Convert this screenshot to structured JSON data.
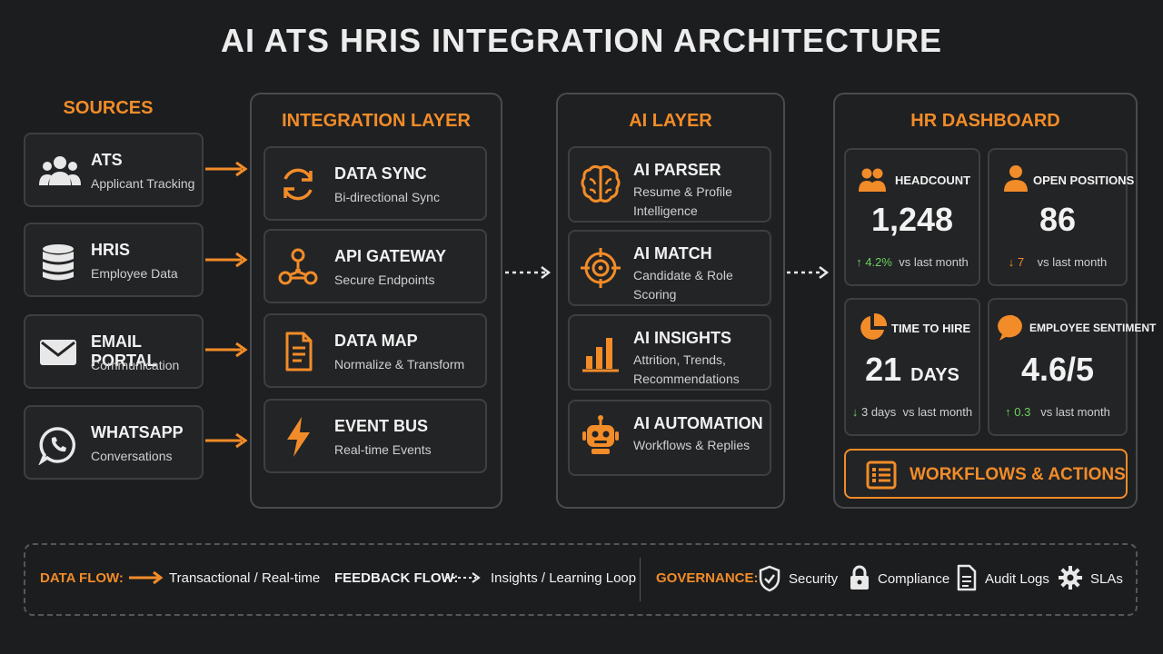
{
  "title": "AI ATS HRIS INTEGRATION ARCHITECTURE",
  "sources": {
    "title": "SOURCES",
    "items": [
      {
        "name": "ATS",
        "desc": "Applicant Tracking",
        "icon": "users-icon"
      },
      {
        "name": "HRIS",
        "desc": "Employee Data",
        "icon": "database-icon"
      },
      {
        "name": "EMAIL PORTAL",
        "desc": "Communication",
        "icon": "mail-icon"
      },
      {
        "name": "WHATSAPP",
        "desc": "Conversations",
        "icon": "whatsapp-icon"
      }
    ]
  },
  "integration": {
    "title": "INTEGRATION LAYER",
    "items": [
      {
        "name": "DATA SYNC",
        "desc": "Bi-directional Sync",
        "icon": "sync-icon"
      },
      {
        "name": "API GATEWAY",
        "desc": "Secure Endpoints",
        "icon": "network-icon"
      },
      {
        "name": "DATA MAP",
        "desc": "Normalize & Transform",
        "icon": "document-icon"
      },
      {
        "name": "EVENT BUS",
        "desc": "Real-time Events",
        "icon": "lightning-icon"
      }
    ]
  },
  "ai": {
    "title": "AI LAYER",
    "items": [
      {
        "name": "AI PARSER",
        "desc": "Resume & Profile Intelligence",
        "icon": "brain-icon"
      },
      {
        "name": "AI MATCH",
        "desc": "Candidate & Role Scoring",
        "icon": "target-icon"
      },
      {
        "name": "AI INSIGHTS",
        "desc": "Attrition, Trends, Recommendations",
        "icon": "bar-chart-icon"
      },
      {
        "name": "AI AUTOMATION",
        "desc": "Workflows & Replies",
        "icon": "robot-icon"
      }
    ]
  },
  "dashboard": {
    "title": "HR DASHBOARD",
    "kpis": [
      {
        "label": "HEADCOUNT",
        "value": "1,248",
        "delta": "4.2%",
        "delta_suffix": "vs last month",
        "direction": "up",
        "icon": "people-icon"
      },
      {
        "label": "OPEN POSITIONS",
        "value": "86",
        "delta": "7",
        "delta_suffix": "vs last month",
        "direction": "down",
        "icon": "person-icon"
      },
      {
        "label": "TIME TO HIRE",
        "value": "21",
        "unit": "DAYS",
        "delta": "3 days",
        "delta_suffix": "vs last month",
        "direction": "down",
        "icon": "pie-icon"
      },
      {
        "label": "EMPLOYEE SENTIMENT",
        "value": "4.6/5",
        "delta": "0.3",
        "delta_suffix": "vs last month",
        "direction": "up",
        "icon": "chat-icon"
      }
    ],
    "workflows_label": "WORKFLOWS & ACTIONS"
  },
  "legend": {
    "data_flow_label": "DATA FLOW:",
    "data_flow_desc": "Transactional / Real-time",
    "feedback_label": "FEEDBACK FLOW:",
    "feedback_desc": "Insights / Learning Loop",
    "governance_label": "GOVERNANCE:",
    "governance_items": [
      {
        "label": "Security",
        "icon": "shield-icon"
      },
      {
        "label": "Compliance",
        "icon": "lock-icon"
      },
      {
        "label": "Audit Logs",
        "icon": "document-icon"
      },
      {
        "label": "SLAs",
        "icon": "gear-icon"
      }
    ]
  },
  "colors": {
    "accent": "#f28c28",
    "up": "#6ccf5a",
    "background": "#1c1d1f",
    "border": "#4a4b4e"
  }
}
